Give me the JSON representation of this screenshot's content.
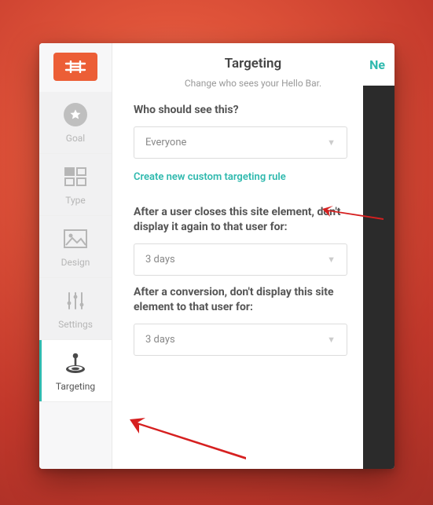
{
  "header": {
    "title": "Targeting",
    "subtitle": "Change who sees your Hello Bar.",
    "ne_text": "Ne"
  },
  "sidebar": {
    "items": [
      {
        "label": "Goal"
      },
      {
        "label": "Type"
      },
      {
        "label": "Design"
      },
      {
        "label": "Settings"
      },
      {
        "label": "Targeting"
      }
    ]
  },
  "form": {
    "q1": "Who should see this?",
    "select1": "Everyone",
    "link": "Create new custom targeting rule",
    "q2": "After a user closes this site element, don't display it again to that user for:",
    "select2": "3 days",
    "q3": "After a conversion, don't display this site element to that user for:",
    "select3": "3 days"
  }
}
